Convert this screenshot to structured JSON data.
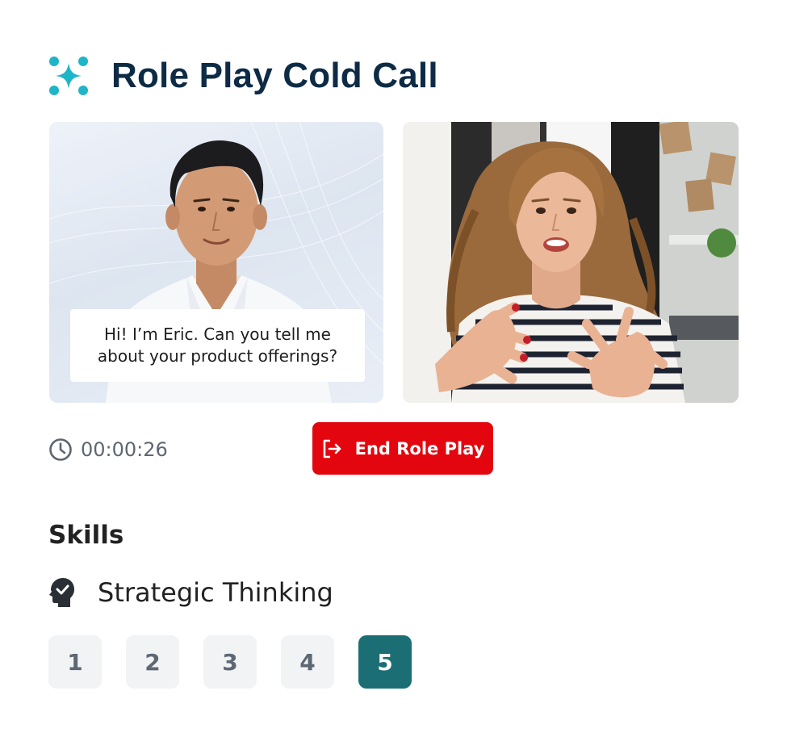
{
  "header": {
    "title": "Role Play Cold Call",
    "icon": "sparkle-icon",
    "icon_color": "#1fb5c8"
  },
  "ai_participant": {
    "caption": "Hi! I’m Eric. Can you tell me about your product offerings?"
  },
  "controls": {
    "timer": "00:00:26",
    "timer_icon": "clock-icon",
    "end_label": "End Role Play",
    "end_icon": "exit-icon",
    "end_color": "#e4060e"
  },
  "skills": {
    "heading": "Skills",
    "skill_name": "Strategic Thinking",
    "skill_icon": "head-check-icon",
    "ratings": [
      "1",
      "2",
      "3",
      "4",
      "5"
    ],
    "selected_rating": "5",
    "selected_color": "#1c6e75"
  }
}
